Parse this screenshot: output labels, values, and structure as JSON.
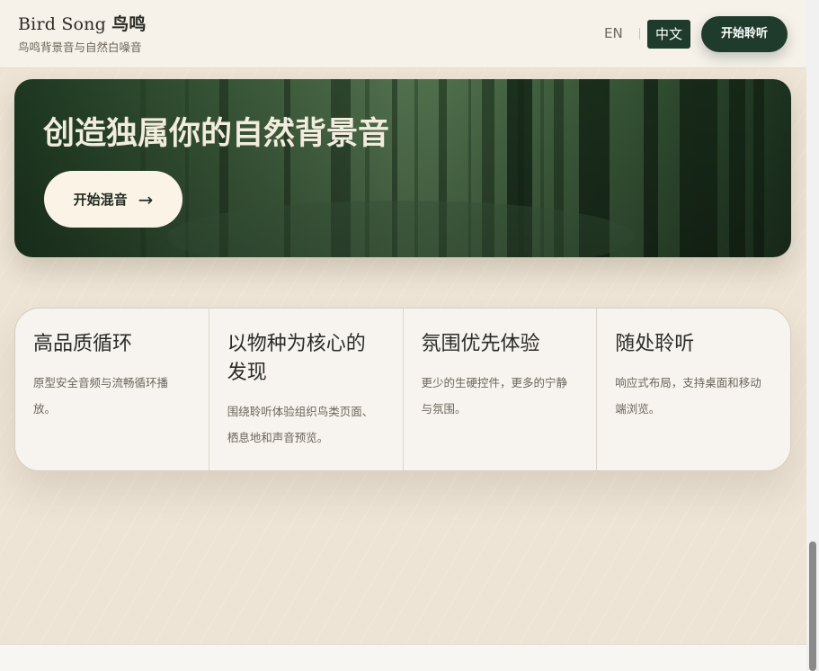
{
  "header": {
    "brand_name": "Bird Song",
    "brand_name_zh": "鸟鸣",
    "brand_subtitle": "鸟鸣背景音与自然白噪音",
    "lang_en": "EN",
    "lang_zh": "中文",
    "cta_label": "开始聆听"
  },
  "hero": {
    "title": "创造独属你的自然背景音",
    "button_label": "开始混音",
    "button_arrow": "→"
  },
  "features": [
    {
      "title": "高品质循环",
      "desc": "原型安全音频与流畅循环播放。"
    },
    {
      "title": "以物种为核心的发现",
      "desc": "围绕聆听体验组织鸟类页面、栖息地和声音预览。"
    },
    {
      "title": "氛围优先体验",
      "desc": "更少的生硬控件，更多的宁静与氛围。"
    },
    {
      "title": "随处聆听",
      "desc": "响应式布局，支持桌面和移动端浏览。"
    }
  ],
  "colors": {
    "accent": "#1f3b2c",
    "page_background": "#ede4d6",
    "hero_button": "#fbf4e6"
  }
}
